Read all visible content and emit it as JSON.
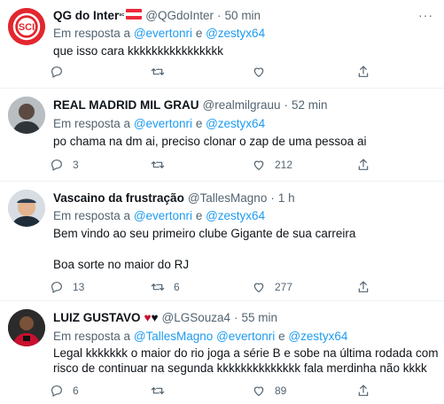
{
  "tweets": [
    {
      "name": "QG do Inter",
      "name_suffix": "ˢᶜ",
      "handle": "@QGdoInter",
      "time": "50 min",
      "reply_prefix": "Em resposta a",
      "reply_mentions": [
        "@evertonri",
        "@zestyx64"
      ],
      "reply_joiner": "e",
      "text": "que isso cara kkkkkkkkkkkkkkkk",
      "counts": {
        "reply": "",
        "retweet": "",
        "like": ""
      }
    },
    {
      "name": "REAL MADRID MIL GRAU",
      "handle": "@realmilgrauu",
      "time": "52 min",
      "reply_prefix": "Em resposta a",
      "reply_mentions": [
        "@evertonri",
        "@zestyx64"
      ],
      "reply_joiner": "e",
      "text": "po chama na dm ai, preciso clonar o zap de uma pessoa ai",
      "counts": {
        "reply": "3",
        "retweet": "",
        "like": "212"
      }
    },
    {
      "name": "Vascaino da frustração",
      "handle": "@TallesMagno",
      "time": "1 h",
      "reply_prefix": "Em resposta a",
      "reply_mentions": [
        "@evertonri",
        "@zestyx64"
      ],
      "reply_joiner": "e",
      "text_line1": "Bem vindo ao seu primeiro clube Gigante de sua carreira",
      "text_line2": "Boa sorte no maior do RJ",
      "counts": {
        "reply": "13",
        "retweet": "6",
        "like": "277"
      }
    },
    {
      "name": "LUIZ GUSTAVO",
      "name_hearts": "♥♥",
      "handle": "@LGSouza4",
      "time": "55 min",
      "reply_prefix": "Em resposta a",
      "reply_mentions": [
        "@TallesMagno",
        "@evertonri",
        "@zestyx64"
      ],
      "reply_joiner": "e",
      "text_line1": "Legal kkkkkkk o maior do rio joga a série B e sobe na última rodada com",
      "text_line2": "risco de continuar na segunda kkkkkkkkkkkkkk fala merdinha não kkkk",
      "counts": {
        "reply": "6",
        "retweet": "",
        "like": "89"
      }
    }
  ],
  "colors": {
    "text": "#0f1419",
    "secondary": "#536471",
    "mention": "#1d9bf0",
    "divider": "#eff3f4",
    "inter_red": "#e3262e"
  },
  "icons": [
    "reply-icon",
    "retweet-icon",
    "like-icon",
    "share-icon",
    "more-icon",
    "austria-flag-icon"
  ]
}
